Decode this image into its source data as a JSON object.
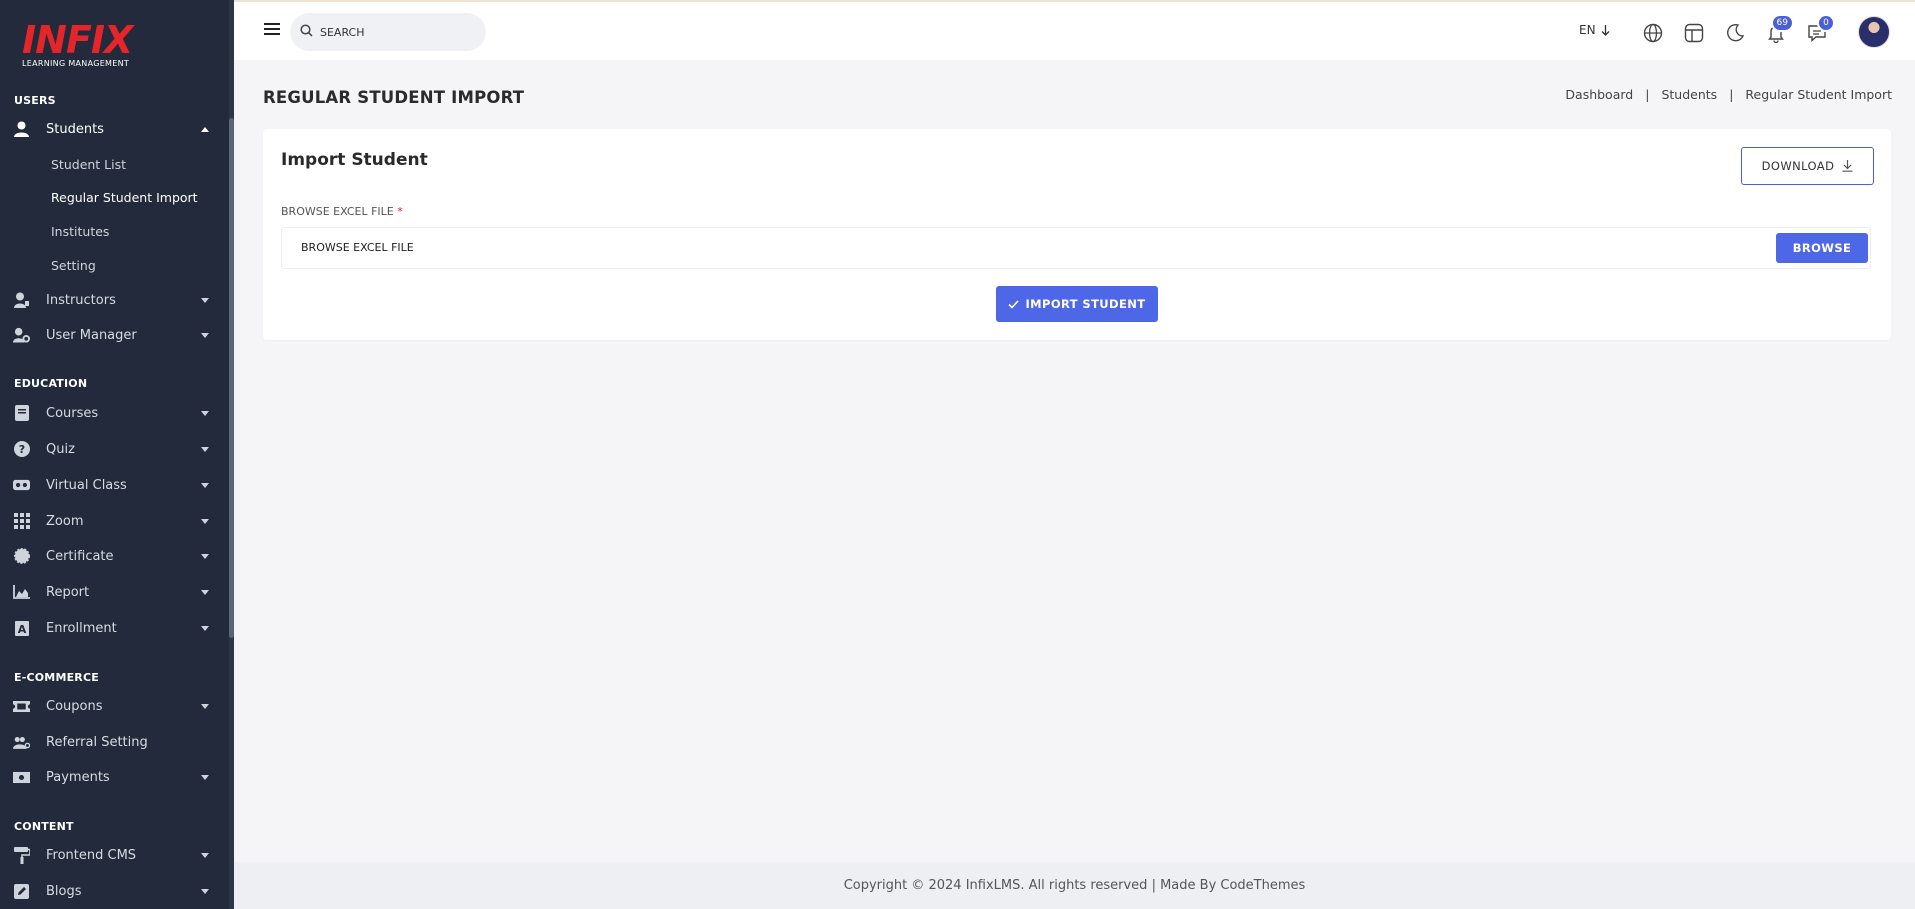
{
  "brand": {
    "logo_text": "INFIX",
    "logo_sub": "LEARNING MANAGEMENT"
  },
  "sidebar": {
    "sections": {
      "users": "USERS",
      "education": "EDUCATION",
      "ecommerce": "E-COMMERCE",
      "content": "CONTENT"
    },
    "students": {
      "label": "Students",
      "sub": [
        "Student List",
        "Regular Student Import",
        "Institutes",
        "Setting"
      ]
    },
    "items": {
      "instructors": "Instructors",
      "user_manager": "User Manager",
      "courses": "Courses",
      "quiz": "Quiz",
      "virtual_class": "Virtual Class",
      "zoom": "Zoom",
      "certificate": "Certificate",
      "report": "Report",
      "enrollment": "Enrollment",
      "coupons": "Coupons",
      "referral_setting": "Referral Setting",
      "payments": "Payments",
      "frontend_cms": "Frontend CMS",
      "blogs": "Blogs"
    }
  },
  "topbar": {
    "search_placeholder": "SEARCH",
    "language": "EN",
    "notifications_count": "69",
    "messages_count": "0"
  },
  "page": {
    "title": "REGULAR STUDENT IMPORT",
    "breadcrumb": [
      "Dashboard",
      "Students",
      "Regular Student Import"
    ]
  },
  "card": {
    "title": "Import Student",
    "download_label": "DOWNLOAD",
    "field_label": "BROWSE EXCEL FILE",
    "required_mark": "*",
    "file_placeholder": "BROWSE EXCEL FILE",
    "browse_label": "BROWSE",
    "import_label": "IMPORT STUDENT"
  },
  "footer": {
    "text": "Copyright © 2024 InfixLMS. All rights reserved | Made By CodeThemes"
  },
  "colors": {
    "sidebar_bg": "#232a3b",
    "primary": "#4e67e6",
    "logo_red": "#e4252a",
    "page_bg": "#f5f5f8"
  }
}
